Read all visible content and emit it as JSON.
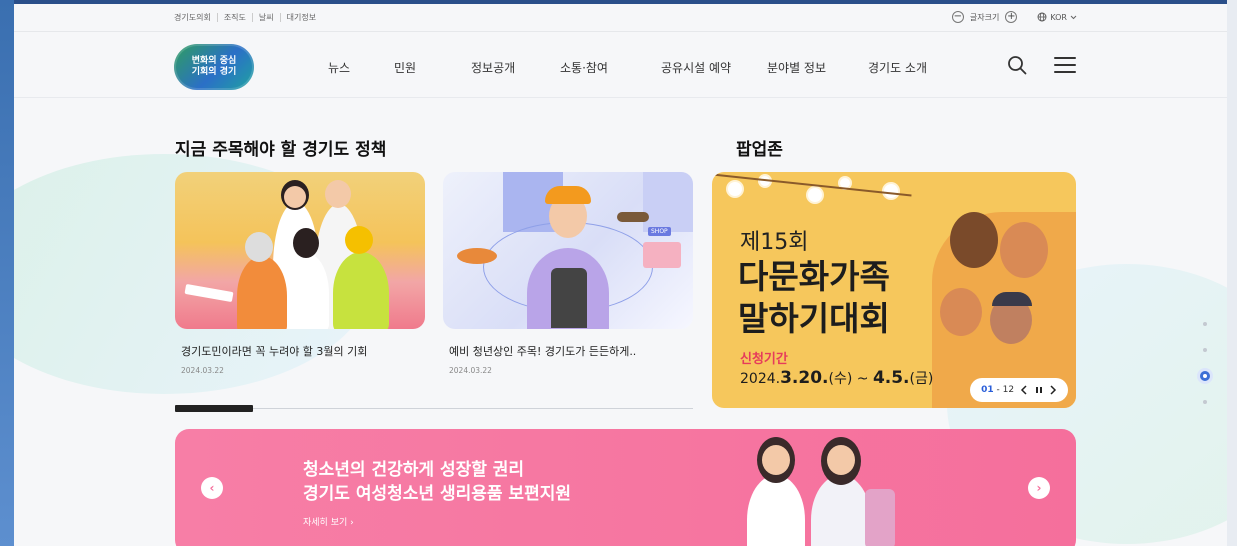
{
  "utility": {
    "links": [
      "경기도의회",
      "조직도",
      "날씨",
      "대기정보"
    ],
    "font_size_label": "글자크기",
    "language": "KOR"
  },
  "header": {
    "logo_line1": "변화의 중심",
    "logo_line2": "기회의 경기",
    "nav": [
      "뉴스",
      "민원",
      "정보공개",
      "소통·참여",
      "공유시설 예약",
      "분야별 정보",
      "경기도 소개"
    ]
  },
  "policy": {
    "title": "지금 주목해야 할 경기도 정책",
    "cards": [
      {
        "caption": "경기도민이라면 꼭 누려야 할 3월의 기회",
        "date": "2024.03.22"
      },
      {
        "caption": "예비 청년상인 주목! 경기도가 든든하게..",
        "date": "2024.03.22"
      }
    ],
    "shop_tag": "SHOP"
  },
  "popup": {
    "title": "팝업존",
    "edition": "제15회",
    "headline_line1": "다문화가족",
    "headline_line2": "말하기대회",
    "period_label": "신청기간",
    "period_prefix": "2024.",
    "period_start": "3.20.",
    "period_start_day": "(수) ~ ",
    "period_end": "4.5.",
    "period_end_day": "(금)",
    "counter_current": "01",
    "counter_total": "12"
  },
  "banner": {
    "line1": "청소년의 건강하게 성장할 권리",
    "line2": "경기도 여성청소년 생리용품 보편지원",
    "more": "자세히 보기"
  },
  "colors": {
    "brand_blue": "#2b5fd9",
    "banner_pink": "#f56f9c",
    "popup_yellow": "#f6c75c",
    "period_red": "#e63b5b"
  }
}
